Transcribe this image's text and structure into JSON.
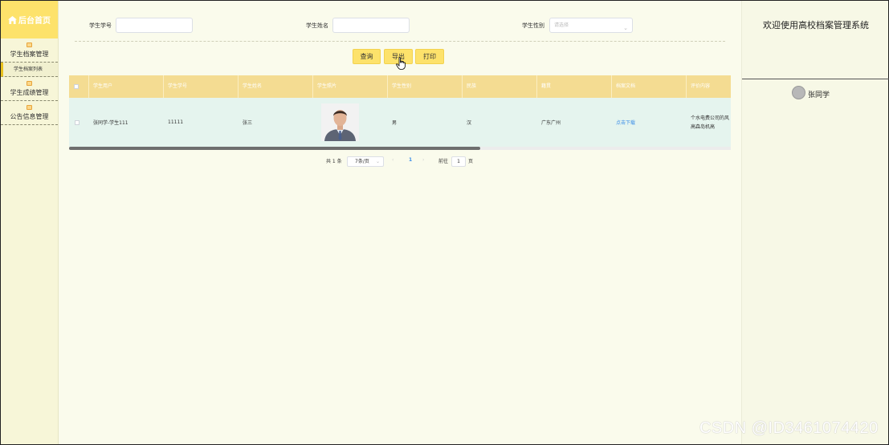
{
  "sidebar": {
    "home_label": "后台首页",
    "menu": [
      {
        "label": "学生档案管理",
        "sub": [
          "学生档案列表"
        ]
      },
      {
        "label": "学生成绩管理"
      },
      {
        "label": "公告信息管理"
      }
    ]
  },
  "filters": {
    "student_no_label": "学生学号",
    "student_name_label": "学生姓名",
    "gender_label": "学生性别",
    "gender_placeholder": "请选择"
  },
  "buttons": {
    "query": "查询",
    "export": "导出",
    "print": "打印"
  },
  "table": {
    "headers": [
      "学生用户",
      "学生学号",
      "学生姓名",
      "学生照片",
      "学生性别",
      "民族",
      "籍贯",
      "档案文档",
      "评价内容"
    ],
    "rows": [
      {
        "user": "张同学-学生111",
        "student_no": "11111",
        "name": "张三",
        "gender": "男",
        "ethnicity": "汉",
        "native_place": "广东广州",
        "document": "点击下载",
        "evaluation": "个水电费公司的风高森岛机高"
      }
    ]
  },
  "pagination": {
    "total": "共 1 条",
    "page_size": "7条/页",
    "current_page": "1",
    "goto_label": "前往",
    "goto_value": "1",
    "page_unit": "页"
  },
  "right_panel": {
    "welcome": "欢迎使用高校档案管理系统",
    "user_name": "张同学"
  },
  "watermark": "CSDN @ID3461074420"
}
